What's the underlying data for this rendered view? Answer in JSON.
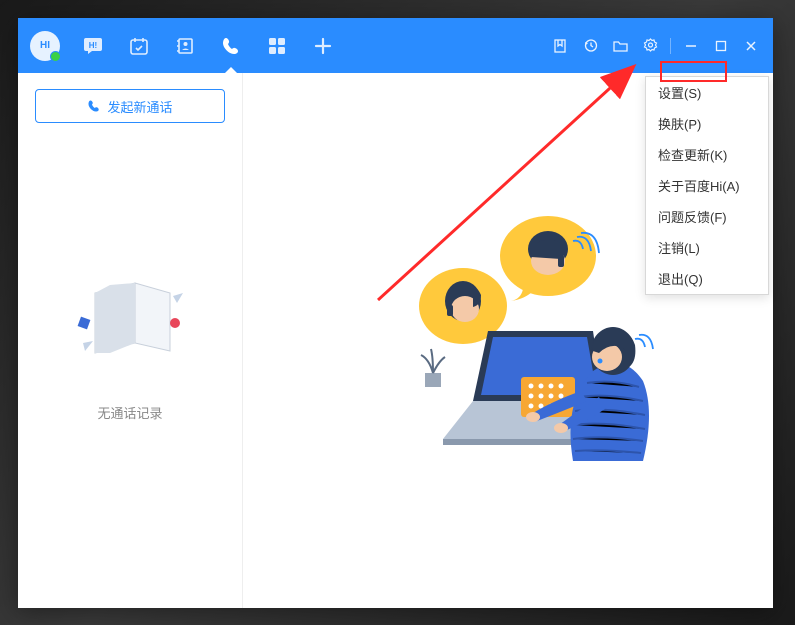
{
  "avatar_text": "HI",
  "sidebar": {
    "new_call_label": "发起新通话",
    "empty_text": "无通话记录"
  },
  "dropdown": {
    "items": [
      "设置(S)",
      "换肤(P)",
      "检查更新(K)",
      "关于百度Hi(A)",
      "问题反馈(F)",
      "注销(L)",
      "退出(Q)"
    ]
  },
  "colors": {
    "primary": "#2a8cff",
    "highlight": "#ff2a2a"
  }
}
